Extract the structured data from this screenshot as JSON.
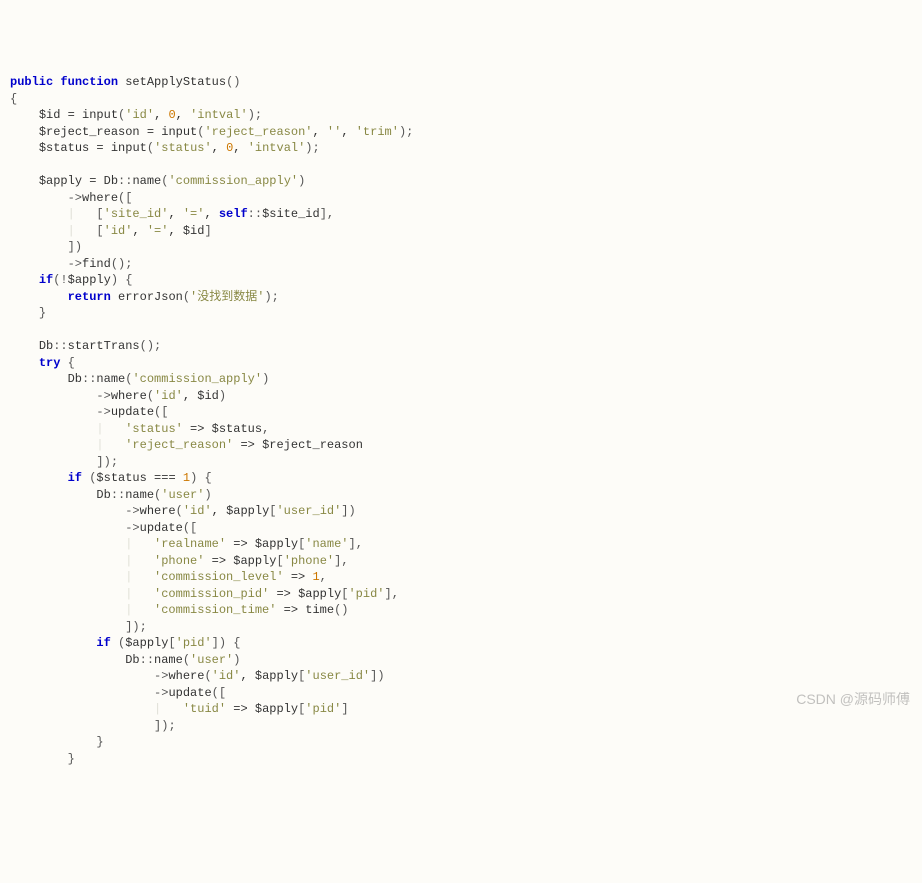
{
  "code": {
    "kw_public": "public",
    "kw_function": "function",
    "fn_name": "setApplyStatus",
    "l1_open": "()",
    "brace_open": "{",
    "brace_close": "}",
    "var_id": "$id",
    "var_reject": "$reject_reason",
    "var_status": "$status",
    "var_apply": "$apply",
    "eq": " = ",
    "input": "input",
    "s_id": "'id'",
    "s_rr": "'reject_reason'",
    "s_status": "'status'",
    "s_intval": "'intval'",
    "s_trim": "'trim'",
    "s_empty": "''",
    "n0": "0",
    "n1": "1",
    "comma": ", ",
    "semi": ";",
    "Db": "Db",
    "dcolon": "::",
    "name": "name",
    "s_comm_apply": "'commission_apply'",
    "s_user": "'user'",
    "arrow": "->",
    "where": "where",
    "find": "find",
    "update": "update",
    "startTrans": "startTrans",
    "s_site_id": "'site_id'",
    "s_eq": "'='",
    "kw_self": "self",
    "site_id_prop": "$site_id",
    "lbrk": "[",
    "rbrk": "]",
    "lpar": "(",
    "rpar": ")",
    "kw_if": "if",
    "kw_return": "return",
    "kw_try": "try",
    "errJson": "errorJson",
    "s_nodata": "'没找到数据'",
    "arrow_assoc": " => ",
    "s_realname": "'realname'",
    "s_name": "'name'",
    "s_phone": "'phone'",
    "s_user_id": "'user_id'",
    "s_comm_level": "'commission_level'",
    "s_comm_pid": "'commission_pid'",
    "s_comm_time": "'commission_time'",
    "s_pid": "'pid'",
    "s_tuid": "'tuid'",
    "time": "time",
    "triple_eq": " === ",
    "bang": "!"
  },
  "watermark": "CSDN @源码师傅"
}
